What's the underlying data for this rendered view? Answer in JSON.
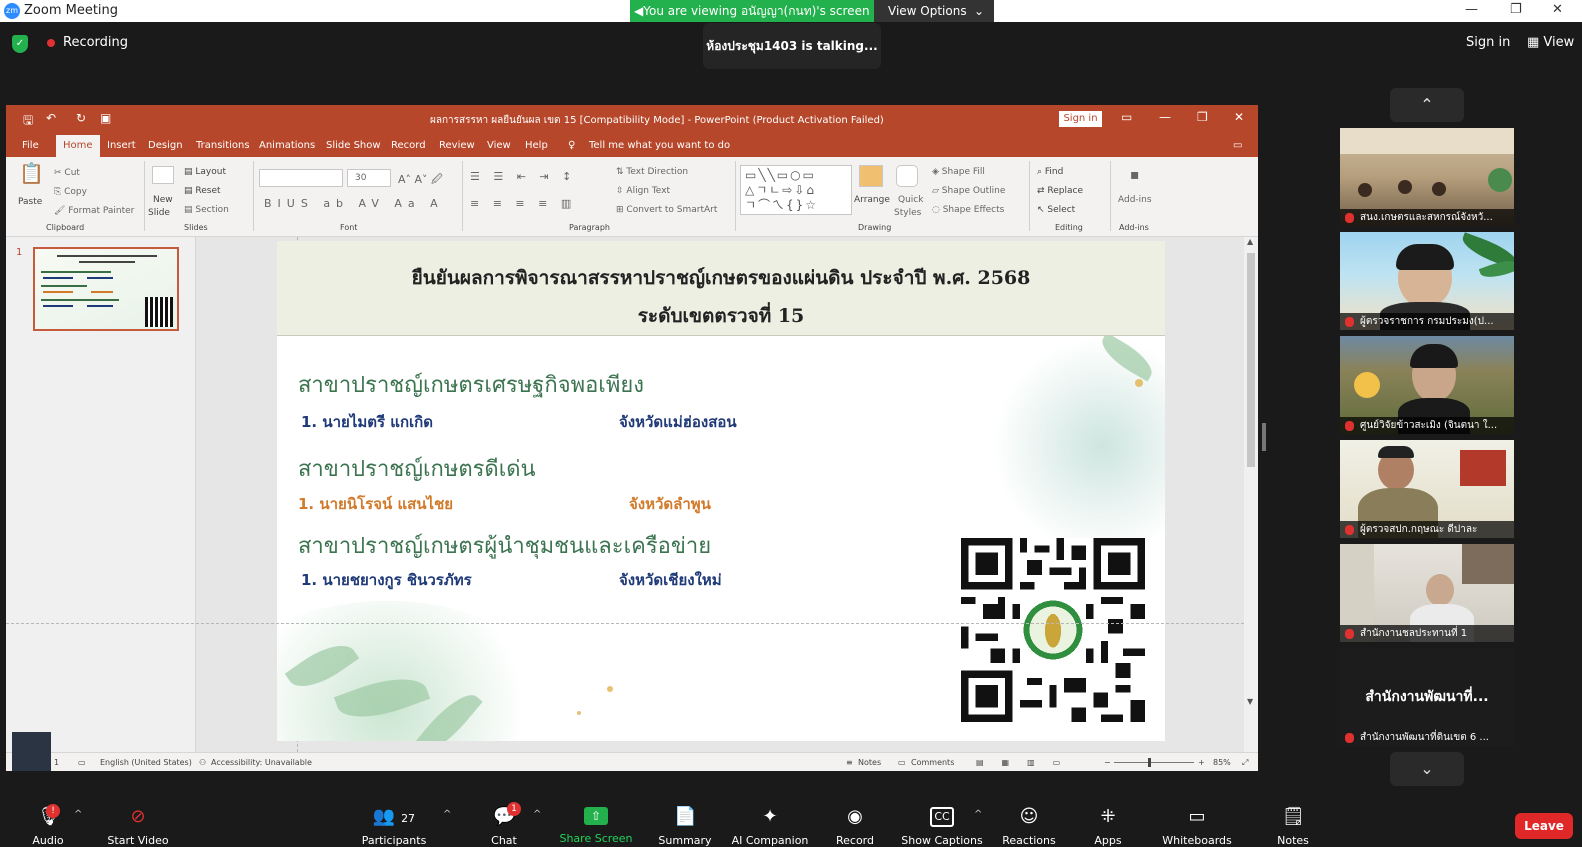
{
  "window": {
    "logo_text": "zm",
    "app_title": "Zoom Meeting",
    "minimize": "—",
    "maximize": "❐",
    "close": "✕"
  },
  "banner": {
    "viewing_text": "You are viewing อนัญญา(กนท)'s screen",
    "view_options": "View Options"
  },
  "meeting": {
    "recording_label": "Recording",
    "talking_text": "ห้องประชุม1403 is  talking...",
    "sign_in": "Sign in",
    "view": "View"
  },
  "powerpoint": {
    "doc_title": "ผลการสรรหา ผลยืนยันผล เขต 15 [Compatibility Mode]  -  PowerPoint (Product Activation Failed)",
    "sign_in": "Sign in",
    "tabs": [
      "File",
      "Home",
      "Insert",
      "Design",
      "Transitions",
      "Animations",
      "Slide Show",
      "Record",
      "Review",
      "View",
      "Help"
    ],
    "tell_me": "Tell me what you want to do",
    "ribbon": {
      "paste": "Paste",
      "cut": "Cut",
      "copy": "Copy",
      "format_painter": "Format Painter",
      "clipboard": "Clipboard",
      "new_slide_1": "New",
      "new_slide_2": "Slide",
      "layout": "Layout",
      "reset": "Reset",
      "section": "Section",
      "slides": "Slides",
      "font_size": "30",
      "font": "Font",
      "text_direction": "Text Direction",
      "align_text": "Align Text",
      "convert_smartart": "Convert to SmartArt",
      "paragraph": "Paragraph",
      "arrange": "Arrange",
      "quick_styles_1": "Quick",
      "quick_styles_2": "Styles",
      "shape_fill": "Shape Fill",
      "shape_outline": "Shape Outline",
      "shape_effects": "Shape Effects",
      "drawing": "Drawing",
      "find": "Find",
      "replace": "Replace",
      "select": "Select",
      "editing": "Editing",
      "addins": "Add-ins",
      "addins_group": "Add-ins"
    },
    "thumb_number": "1",
    "status": {
      "slide_number": "1",
      "language": "English (United States)",
      "accessibility": "Accessibility: Unavailable",
      "notes": "Notes",
      "comments": "Comments",
      "zoom": "85%"
    }
  },
  "slide": {
    "title_line1": "ยืนยันผลการพิจารณาสรรหาปราชญ์เกษตรของแผ่นดิน ประจำปี พ.ศ. 2568",
    "title_line2": "ระดับเขตตรวจที่ 15",
    "categories": [
      {
        "heading": "สาขาปราชญ์เกษตรเศรษฐกิจพอเพียง",
        "name": "1.  นายไมตรี แกเกิด",
        "province": "จังหวัดแม่ฮ่องสอน",
        "color": "#1f3a78"
      },
      {
        "heading": "สาขาปราชญ์เกษตรดีเด่น",
        "name": "1. นายนิโรจน์ แสนไชย",
        "province": "จังหวัดลำพูน",
        "color": "#d17a2a"
      },
      {
        "heading": "สาขาปราชญ์เกษตรผู้นำชุมชนและเครือข่าย",
        "name": "1. นายชยางกูร ชินวรภัทร",
        "province": "จังหวัดเชียงใหม่",
        "color": "#1f3a78"
      }
    ]
  },
  "gallery": {
    "up": "⌃",
    "down": "⌄",
    "participants": [
      {
        "label": "สนง.เกษตรและสหกรณ์จังหวั..."
      },
      {
        "label": "ผู้ตรวจราชการ กรมประมง(ป..."
      },
      {
        "label": "ศูนย์วิจัยข้าวสะเมิง (จินตนา ใ..."
      },
      {
        "label": "ผู้ตรวจสปก.กฤษณะ ดีปาละ"
      },
      {
        "label": "สำนักงานชลประทานที่ 1"
      },
      {
        "label": "สำนักงานพัฒนาที่ดินเขต 6 ..."
      }
    ],
    "name_only_tile": "สำนักงานพัฒนาที่..."
  },
  "toolbar": {
    "audio": "Audio",
    "start_video": "Start Video",
    "participants": "Participants",
    "participants_count": "27",
    "chat": "Chat",
    "chat_badge": "1",
    "share_screen": "Share Screen",
    "summary": "Summary",
    "ai_companion": "AI Companion",
    "record": "Record",
    "show_captions": "Show Captions",
    "reactions": "Reactions",
    "apps": "Apps",
    "whiteboards": "Whiteboards",
    "notes": "Notes",
    "leave": "Leave",
    "mute_badge": "!"
  },
  "colors": {
    "zoom_green": "#22b14c",
    "powerpoint_red": "#b7472a",
    "leave_red": "#e02828",
    "slide_green": "#3c7450"
  }
}
